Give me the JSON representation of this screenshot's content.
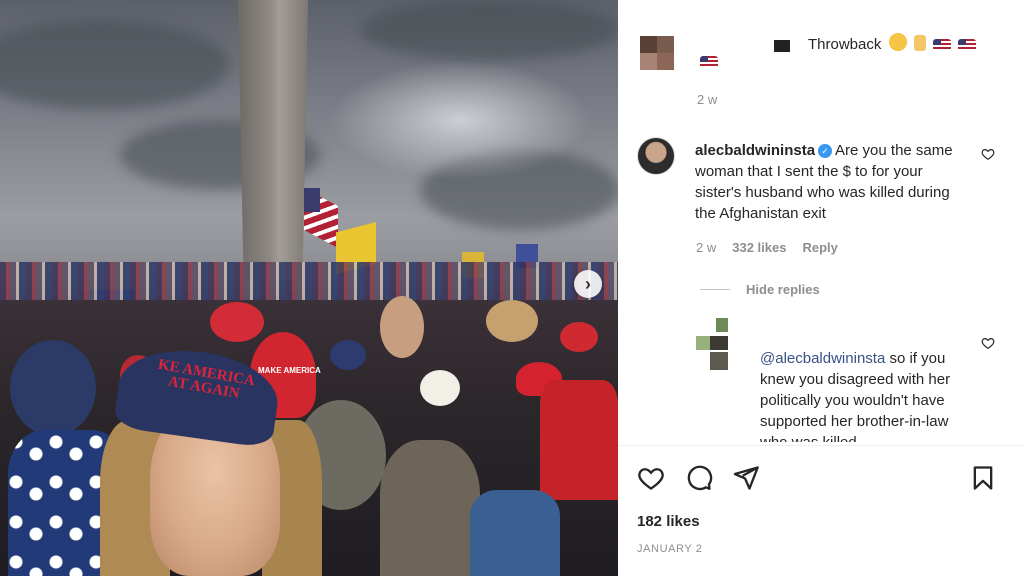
{
  "post": {
    "caption_text": "Throwback",
    "caption_emojis": [
      "grinning-face-emoji",
      "rock-on-hand-emoji",
      "us-flag-emoji",
      "us-flag-emoji"
    ],
    "caption_time": "2 w",
    "photo_red_cap_text": "MAKE AMERICA GREAT AGAIN",
    "photo_big_cap_text": "KE AMERICA AT AGAIN",
    "next_icon": "chevron-right-icon"
  },
  "comment": {
    "username": "alecbaldwininsta",
    "text": "Are you the same woman that I sent the $ to for your sister's husband who was killed during the Afghanistan exit",
    "time": "2 w",
    "likes": "332 likes",
    "reply_label": "Reply",
    "hide_replies": "Hide replies"
  },
  "reply": {
    "mention": "@alecbaldwininsta",
    "text": "so if you knew you disagreed with her politically you wouldn't have supported her brother-in-law who was killed"
  },
  "footer": {
    "likes": "182 likes",
    "date": "JANUARY 2"
  },
  "colors": {
    "verified_badge": "#3897f0",
    "mention": "#385185",
    "muted_text": "#8e8e8e"
  }
}
